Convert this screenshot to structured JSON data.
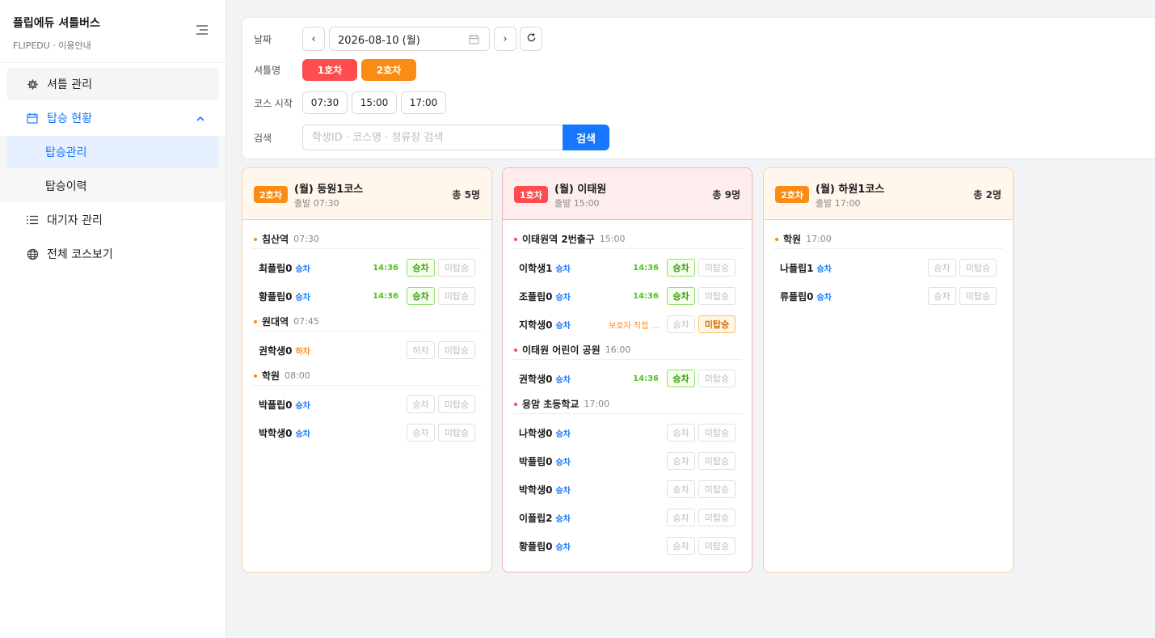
{
  "brand": {
    "title": "플립에듀 셔틀버스",
    "subtitle": "FLIPEDU · 이용안내"
  },
  "sidebar": {
    "items": [
      {
        "label": "셔틀 관리",
        "icon": "gear-icon"
      },
      {
        "label": "탑승 현황",
        "icon": "calendar-icon",
        "expanded": true,
        "children": [
          {
            "label": "탑승관리",
            "active": true
          },
          {
            "label": "탑승이력"
          }
        ]
      },
      {
        "label": "대기자 관리",
        "icon": "list-icon"
      },
      {
        "label": "전체 코스보기",
        "icon": "globe-icon"
      }
    ]
  },
  "filter": {
    "date_label": "날짜",
    "date_value": "2026-08-10 (월)",
    "prev": "‹",
    "next": "›",
    "shuttle_label": "셔틀명",
    "shuttles": [
      {
        "label": "1호차",
        "color": "#ff4d4f"
      },
      {
        "label": "2호차",
        "color": "#fa8c16"
      }
    ],
    "course_label": "코스 시작",
    "times": [
      "07:30",
      "15:00",
      "17:00"
    ],
    "search_label": "검색",
    "search_placeholder": "학생ID · 코스명 · 정류장 검색",
    "search_button": "검색"
  },
  "colors": {
    "orange": "#fa8c16",
    "red": "#ff4d4f",
    "blue": "#1677ff",
    "green": "#52c41a"
  },
  "cards": [
    {
      "badge": "2호차",
      "title": "(월) 등원1코스",
      "sub": "출발 07:30",
      "total": "총 5명",
      "stops": [
        {
          "name": "침산역",
          "time": "07:30",
          "students": [
            {
              "name": "최플립0",
              "type": "승차",
              "rtime": "14:36",
              "board_label": "승차",
              "miss_label": "미탑승",
              "board_on": true
            },
            {
              "name": "황플립0",
              "type": "승차",
              "rtime": "14:36",
              "board_label": "승차",
              "miss_label": "미탑승",
              "board_on": true
            }
          ]
        },
        {
          "name": "원대역",
          "time": "07:45",
          "students": [
            {
              "name": "권학생0",
              "type": "하차",
              "board_label": "하차",
              "miss_label": "미탑승"
            }
          ]
        },
        {
          "name": "학원",
          "time": "08:00",
          "students": [
            {
              "name": "박플립0",
              "type": "승차",
              "board_label": "승차",
              "miss_label": "미탑승"
            },
            {
              "name": "박학생0",
              "type": "승차",
              "board_label": "승차",
              "miss_label": "미탑승"
            }
          ]
        }
      ]
    },
    {
      "badge": "1호차",
      "title": "(월) 이태원",
      "sub": "출발 15:00",
      "total": "총 9명",
      "stops": [
        {
          "name": "이태원역 2번출구",
          "time": "15:00",
          "students": [
            {
              "name": "이학생1",
              "type": "승차",
              "rtime": "14:36",
              "board_label": "승차",
              "miss_label": "미탑승",
              "board_on": true
            },
            {
              "name": "조플립0",
              "type": "승차",
              "rtime": "14:36",
              "board_label": "승차",
              "miss_label": "미탑승",
              "board_on": true
            },
            {
              "name": "지학생0",
              "type": "승차",
              "note": "보호자 직접 ...",
              "board_label": "승차",
              "miss_label": "미탑승",
              "miss_on": true
            }
          ]
        },
        {
          "name": "이태원 어린이 공원",
          "time": "16:00",
          "students": [
            {
              "name": "권학생0",
              "type": "승차",
              "rtime": "14:36",
              "board_label": "승차",
              "miss_label": "미탑승",
              "board_on": true
            }
          ]
        },
        {
          "name": "용암 초등학교",
          "time": "17:00",
          "students": [
            {
              "name": "나학생0",
              "type": "승차",
              "board_label": "승차",
              "miss_label": "미탑승"
            },
            {
              "name": "박플립0",
              "type": "승차",
              "board_label": "승차",
              "miss_label": "미탑승"
            },
            {
              "name": "박학생0",
              "type": "승차",
              "board_label": "승차",
              "miss_label": "미탑승"
            },
            {
              "name": "이플립2",
              "type": "승차",
              "board_label": "승차",
              "miss_label": "미탑승"
            },
            {
              "name": "황플립0",
              "type": "승차",
              "board_label": "승차",
              "miss_label": "미탑승"
            }
          ]
        }
      ]
    },
    {
      "badge": "2호차",
      "title": "(월) 하원1코스",
      "sub": "출발 17:00",
      "total": "총 2명",
      "stops": [
        {
          "name": "학원",
          "time": "17:00",
          "students": [
            {
              "name": "나플립1",
              "type": "승차",
              "board_label": "승차",
              "miss_label": "미탑승"
            },
            {
              "name": "류플립0",
              "type": "승차",
              "board_label": "승차",
              "miss_label": "미탑승"
            }
          ]
        }
      ]
    }
  ]
}
